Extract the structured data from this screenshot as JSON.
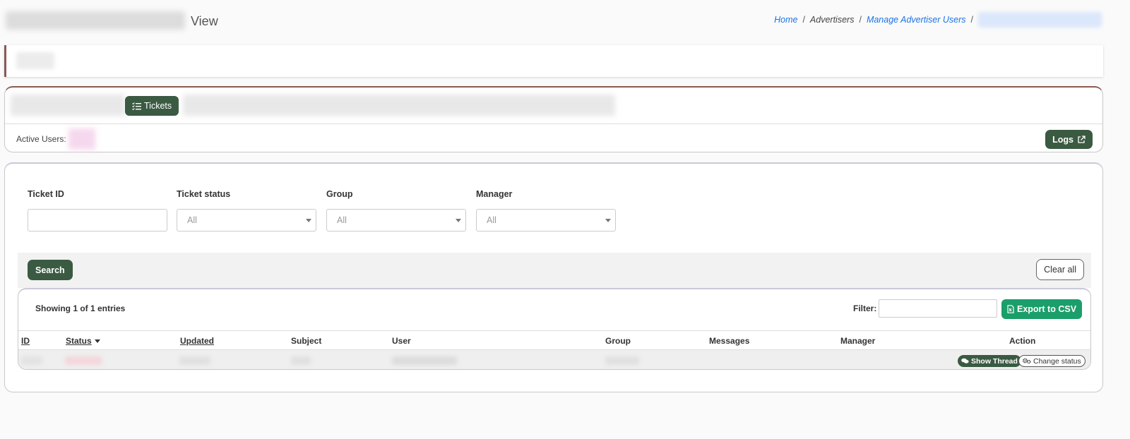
{
  "header": {
    "title": "View",
    "breadcrumb": {
      "home": "Home",
      "advertisers": "Advertisers",
      "manage": "Manage Advertiser Users",
      "separator": "/"
    }
  },
  "tabs": {
    "tickets_label": "Tickets"
  },
  "users_bar": {
    "active_users_label": "Active Users:",
    "logs_label": "Logs"
  },
  "filters": {
    "ticket_id_label": "Ticket ID",
    "ticket_status_label": "Ticket status",
    "ticket_status_value": "All",
    "group_label": "Group",
    "group_value": "All",
    "manager_label": "Manager",
    "manager_value": "All",
    "search_label": "Search",
    "clear_label": "Clear all"
  },
  "table": {
    "showing_text": "Showing 1 of 1 entries",
    "filter_label": "Filter:",
    "export_label": "Export to CSV",
    "columns": [
      "ID",
      "Status",
      "Updated",
      "Subject",
      "User",
      "Group",
      "Messages",
      "Manager",
      "Action"
    ],
    "row_actions": {
      "show_thread": "Show Thread",
      "change_status": "Change status"
    }
  }
}
